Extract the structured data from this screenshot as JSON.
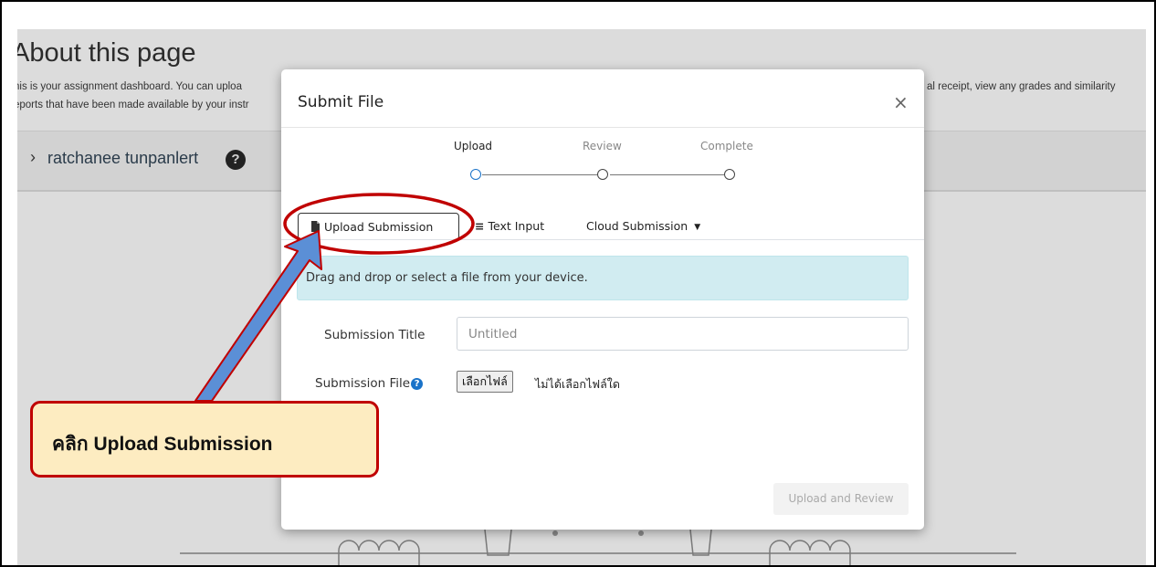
{
  "page": {
    "about_title": "About this page",
    "description_line1_left": "his is your assignment dashboard. You can uploa",
    "description_line1_right": "al receipt, view any grades and similarity",
    "description_line2_left": "eports that have been made available by your instr",
    "user_name": "ratchanee tunpanlert"
  },
  "modal": {
    "title": "Submit File",
    "close": "×",
    "steps": [
      {
        "label": "Upload",
        "active": true
      },
      {
        "label": "Review",
        "active": false
      },
      {
        "label": "Complete",
        "active": false
      }
    ],
    "tabs": {
      "upload": "Upload Submission",
      "text": "Text Input",
      "cloud": "Cloud Submission"
    },
    "dropzone_text": "Drag and drop or select a file from your device.",
    "title_label": "Submission Title",
    "title_placeholder": "Untitled",
    "file_label": "Submission File",
    "file_button": "เลือกไฟล์",
    "file_status": "ไม่ได้เลือกไฟล์ใด",
    "submit_button": "Upload and Review"
  },
  "callout": {
    "text": "คลิก Upload Submission"
  },
  "colors": {
    "accent": "#1a73c9",
    "annotation_red": "#c00000",
    "annotation_fill": "#fdecc1",
    "arrow_fill": "#5b8fd6",
    "info_bg": "#d1ecf1"
  },
  "icons": [
    "help-circle-icon",
    "chevron-right-icon",
    "document-icon",
    "list-icon",
    "caret-down-icon",
    "close-icon"
  ]
}
